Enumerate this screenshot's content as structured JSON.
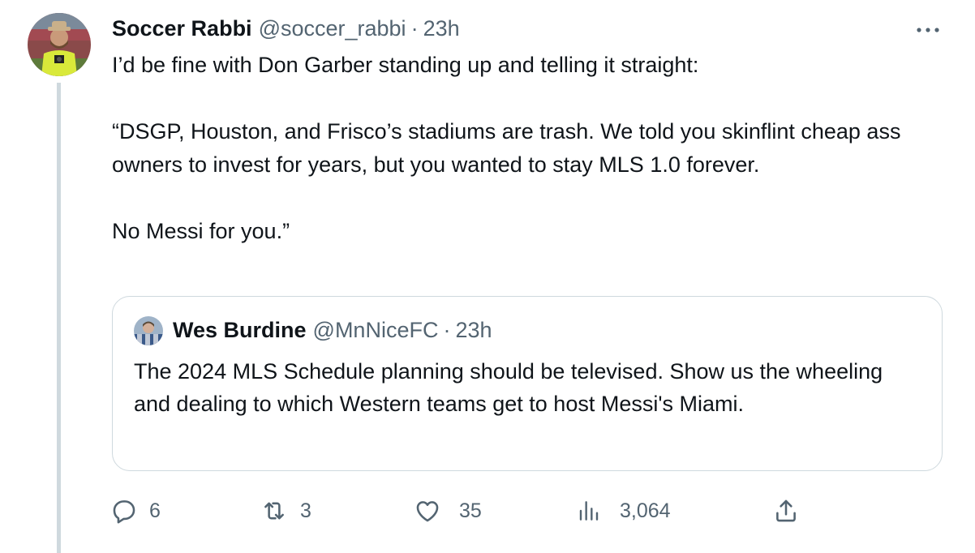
{
  "tweet": {
    "author_name": "Soccer Rabbi",
    "author_handle": "@soccer_rabbi",
    "separator": "·",
    "time": "23h",
    "more_label": "···",
    "text": [
      "I’d be fine with Don Garber standing up and telling it straight:",
      "“DSGP, Houston, and Frisco’s stadiums are trash. We told you skinflint cheap ass owners to invest for years, but you wanted to stay MLS 1.0 forever.",
      "No Messi for you.”"
    ]
  },
  "quoted_tweet": {
    "author_name": "Wes Burdine",
    "author_handle": "@MnNiceFC",
    "separator": "·",
    "time": "23h",
    "text": "The 2024 MLS Schedule planning should be televised. Show us the wheeling and dealing to which Western teams get to host Messi's Miami."
  },
  "actions": {
    "replies": "6",
    "retweets": "3",
    "likes": "35",
    "views": "3,064"
  },
  "icons": {
    "reply": "reply-icon",
    "retweet": "retweet-icon",
    "like": "heart-icon",
    "views": "views-chart-icon",
    "share": "share-icon",
    "more": "more-dots-icon"
  },
  "colors": {
    "text": "#0f1419",
    "secondary": "#536471",
    "border": "#cfd9de"
  }
}
